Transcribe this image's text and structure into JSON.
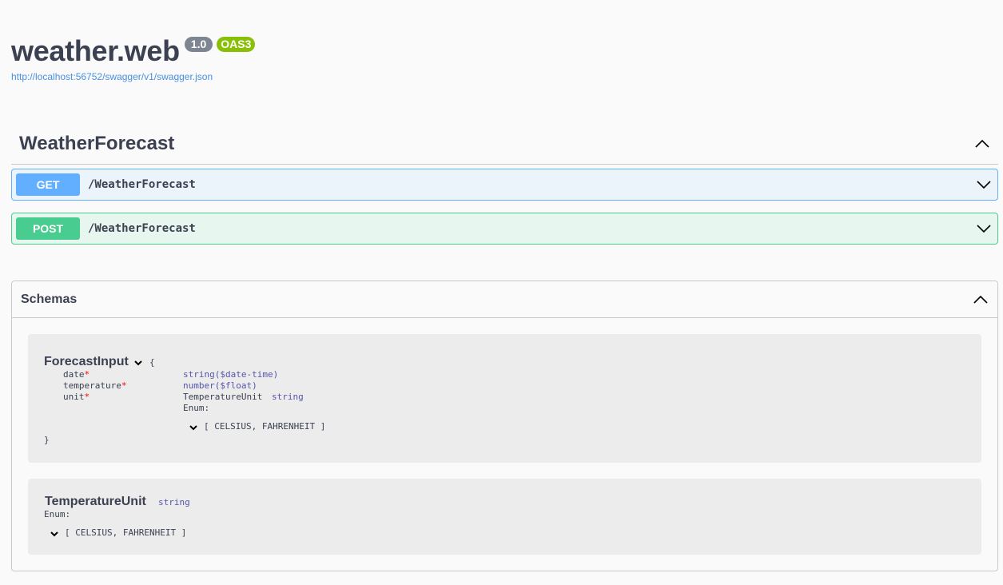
{
  "info": {
    "title": "weather.web",
    "version": "1.0",
    "oas": "OAS3",
    "url": "http://localhost:56752/swagger/v1/swagger.json"
  },
  "tag": {
    "name": "WeatherForecast",
    "expanded": true
  },
  "operations": [
    {
      "method": "GET",
      "path": "/WeatherForecast",
      "color": "#61affe"
    },
    {
      "method": "POST",
      "path": "/WeatherForecast",
      "color": "#49cc90"
    }
  ],
  "schemas": {
    "title": "Schemas",
    "forecast_input": {
      "name": "ForecastInput",
      "open_brace": "{",
      "close_brace": "}",
      "properties": [
        {
          "name": "date",
          "required": "*",
          "type": "string($date-time)"
        },
        {
          "name": "temperature",
          "required": "*",
          "type": "number($float)"
        },
        {
          "name": "unit",
          "required": "*",
          "type_ref": "TemperatureUnit",
          "type": "string",
          "enum_label": "Enum:",
          "enum_values": "[ CELSIUS, FAHRENHEIT ]"
        }
      ]
    },
    "temperature_unit": {
      "name": "TemperatureUnit",
      "type": "string",
      "enum_label": "Enum:",
      "enum_values": "[ CELSIUS, FAHRENHEIT ]"
    }
  }
}
